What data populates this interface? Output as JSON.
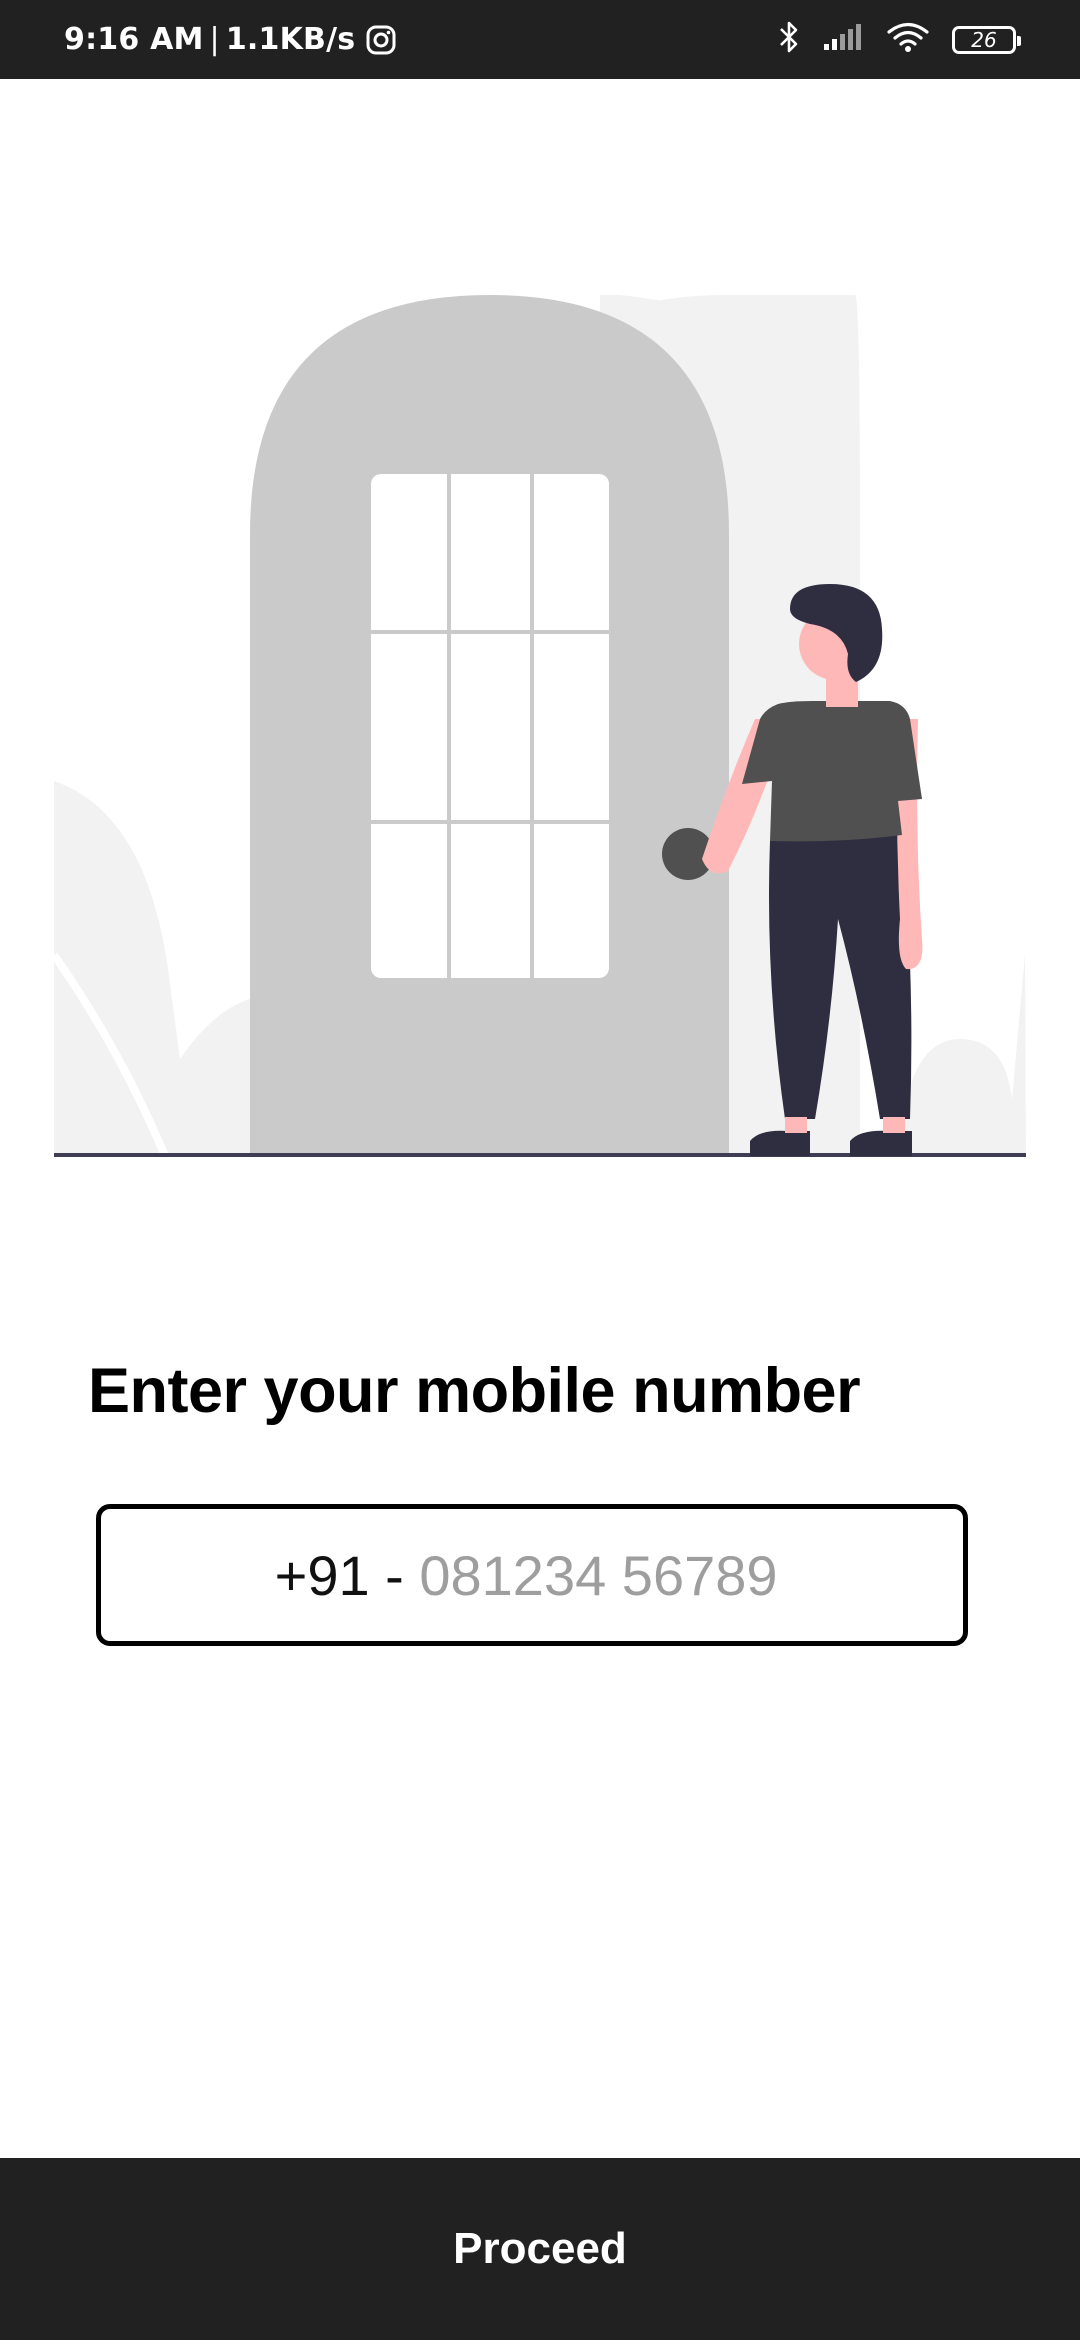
{
  "status_bar": {
    "time": "9:16 AM",
    "separator": "|",
    "network_speed": "1.1KB/s",
    "battery_level": "26",
    "icons": [
      "instagram-icon",
      "bluetooth-icon",
      "signal-icon",
      "wifi-icon",
      "battery-icon"
    ]
  },
  "illustration": {
    "name": "person-at-door-illustration",
    "colors": {
      "door": "#cacaca",
      "background_shape": "#f2f2f2",
      "shirt": "#505050",
      "pants": "#2f2e41",
      "skin": "#ffb8b8",
      "hair": "#2f2e41",
      "ground": "#3f3d56"
    }
  },
  "title": "Enter your mobile number",
  "phone": {
    "prefix": "+91 - ",
    "value": "",
    "placeholder": "081234 56789"
  },
  "proceed_label": "Proceed",
  "colors": {
    "status_bar_bg": "#212121",
    "button_bg": "#212121",
    "button_text": "#ffffff",
    "placeholder": "#9e9e9e"
  }
}
